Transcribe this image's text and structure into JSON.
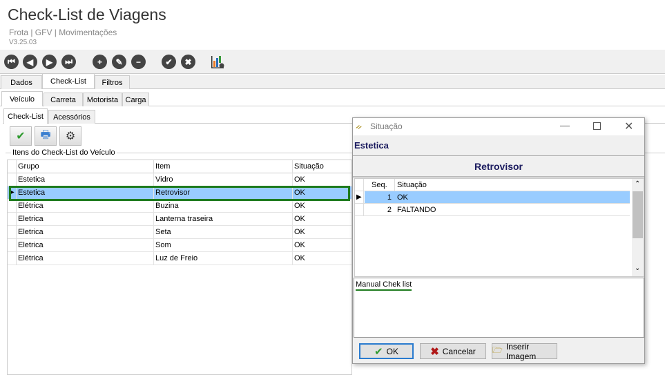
{
  "app": {
    "title": "Check-List de Viagens",
    "breadcrumb": "Frota | GFV | Movimentações",
    "version": "V3.25.03"
  },
  "toolbar": [
    {
      "icon": "first-icon",
      "g": "⏮"
    },
    {
      "icon": "prev-icon",
      "g": "◀"
    },
    {
      "icon": "next-icon",
      "g": "▶"
    },
    {
      "icon": "last-icon",
      "g": "⏭"
    },
    {
      "icon": "add-icon",
      "g": "+"
    },
    {
      "icon": "edit-icon",
      "g": "✎"
    },
    {
      "icon": "remove-icon",
      "g": "−"
    },
    {
      "icon": "confirm-icon",
      "g": "✔"
    },
    {
      "icon": "cancel-icon",
      "g": "✖"
    }
  ],
  "tabs1": [
    "Dados",
    "Check-List",
    "Filtros"
  ],
  "tabs2": [
    "Veículo",
    "Carreta",
    "Motorista",
    "Carga"
  ],
  "tabs3": [
    "Check-List",
    "Acessórios"
  ],
  "group_label": "Itens do Check-List do Veículo",
  "grid": {
    "headers": [
      "Grupo",
      "Item",
      "Situação"
    ],
    "rows": [
      [
        "Estetica",
        "Vidro",
        "OK"
      ],
      [
        "Estetica",
        "Retrovisor",
        "OK"
      ],
      [
        "Elétrica",
        "Buzina",
        "OK"
      ],
      [
        "Eletrica",
        "Lanterna traseira",
        "OK"
      ],
      [
        "Eletrica",
        "Seta",
        "OK"
      ],
      [
        "Eletrica",
        "Som",
        "OK"
      ],
      [
        "Elétrica",
        "Luz de Freio",
        "OK"
      ]
    ]
  },
  "dialog": {
    "title": "Situação",
    "group": "Estetica",
    "item": "Retrovisor",
    "headers": [
      "Seq.",
      "Situação"
    ],
    "rows": [
      [
        "1",
        "OK"
      ],
      [
        "2",
        "FALTANDO"
      ]
    ],
    "memo": "Manual Chek list",
    "ok": "OK",
    "cancel": "Cancelar",
    "insert": "Inserir Imagem"
  },
  "colors": {
    "selected": "#99ccff",
    "highlight": "#1e7b1e",
    "header_text": "#1a1a5e"
  }
}
